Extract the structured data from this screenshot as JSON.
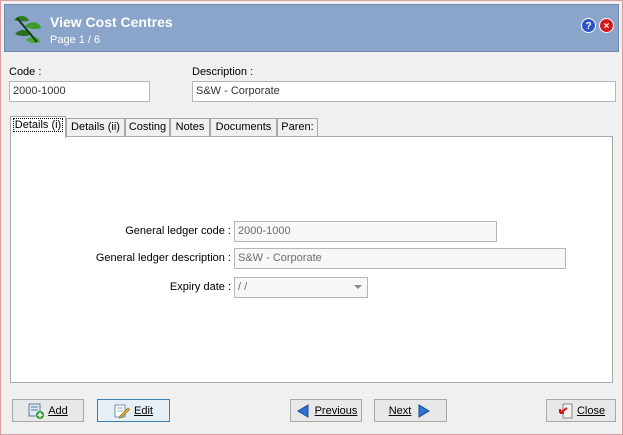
{
  "window": {
    "title": "View Cost Centres",
    "page_indicator": "Page 1 / 6",
    "help_icon": "?",
    "close_icon": "×"
  },
  "header_fields": {
    "code_label": "Code :",
    "code_value": "2000-1000",
    "description_label": "Description :",
    "description_value": "S&W - Corporate"
  },
  "tabs": [
    {
      "label": "Details (i)",
      "active": true
    },
    {
      "label": "Details (ii)",
      "active": false
    },
    {
      "label": "Costing",
      "active": false
    },
    {
      "label": "Notes",
      "active": false
    },
    {
      "label": "Documents",
      "active": false
    },
    {
      "label": "Paren:",
      "active": false
    }
  ],
  "details": {
    "gl_code_label": "General ledger code :",
    "gl_code_value": "2000-1000",
    "gl_desc_label": "General ledger description :",
    "gl_desc_value": "S&W - Corporate",
    "expiry_label": "Expiry date :",
    "expiry_value": " /  /"
  },
  "buttons": {
    "add": "Add",
    "edit": "Edit",
    "previous": "Previous",
    "next": "Next",
    "close": "Close"
  },
  "colors": {
    "titlebar": "#8aa5c9",
    "focus_border": "#3c7fb1"
  }
}
